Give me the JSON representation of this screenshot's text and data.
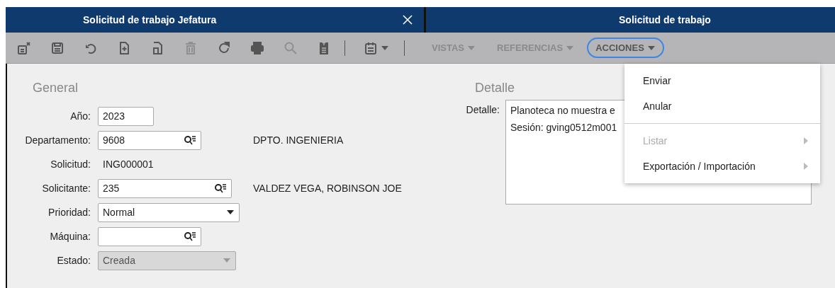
{
  "tabs": [
    {
      "title": "Solicitud de trabajo Jefatura",
      "closable": true
    },
    {
      "title": "Solicitud de trabajo",
      "closable": false
    }
  ],
  "toolbar": {
    "icons": [
      {
        "kind": "clear",
        "disabled": false
      },
      {
        "kind": "save",
        "disabled": false
      },
      {
        "kind": "undo",
        "disabled": false
      },
      {
        "kind": "new",
        "disabled": false
      },
      {
        "kind": "copy",
        "disabled": false
      },
      {
        "kind": "delete",
        "disabled": true
      },
      {
        "kind": "refresh",
        "disabled": false
      },
      {
        "kind": "print",
        "disabled": false
      },
      {
        "kind": "search",
        "disabled": true
      },
      {
        "kind": "import",
        "disabled": false
      },
      {
        "kind": "calendar",
        "disabled": false
      }
    ],
    "menus": [
      {
        "label": "VISTAS",
        "disabled": true,
        "expanded": false
      },
      {
        "label": "REFERENCIAS",
        "disabled": true,
        "expanded": false
      },
      {
        "label": "ACCIONES",
        "disabled": false,
        "expanded": true
      }
    ]
  },
  "general": {
    "title": "General",
    "fields": [
      {
        "kind": "text",
        "label": "Año:",
        "value": "2023"
      },
      {
        "kind": "lookup",
        "label": "Departamento:",
        "value": "9608",
        "description": "DPTO. INGENIERIA"
      },
      {
        "kind": "static",
        "label": "Solicitud:",
        "value": "ING000001"
      },
      {
        "kind": "lookup",
        "label": "Solicitante:",
        "value": "235",
        "description": "VALDEZ VEGA, ROBINSON JOE"
      },
      {
        "kind": "select",
        "label": "Prioridad:",
        "value": "Normal",
        "disabled": false
      },
      {
        "kind": "lookup",
        "label": "Máquina:"
      },
      {
        "kind": "select",
        "label": "Estado:",
        "value": "Creada",
        "disabled": true
      }
    ]
  },
  "detail": {
    "title": "Detalle",
    "label": "Detalle:",
    "lines": [
      "Planoteca no muestra e",
      "Sesión: gving0512m001"
    ]
  },
  "actions_menu": {
    "items": [
      {
        "kind": "item",
        "label": "Enviar",
        "disabled": false,
        "submenu": false
      },
      {
        "kind": "item",
        "label": "Anular",
        "disabled": false,
        "submenu": false
      },
      {
        "kind": "separator"
      },
      {
        "kind": "item",
        "label": "Listar",
        "disabled": true,
        "submenu": true
      },
      {
        "kind": "item",
        "label": "Exportación / Importación",
        "disabled": false,
        "submenu": true
      }
    ]
  }
}
